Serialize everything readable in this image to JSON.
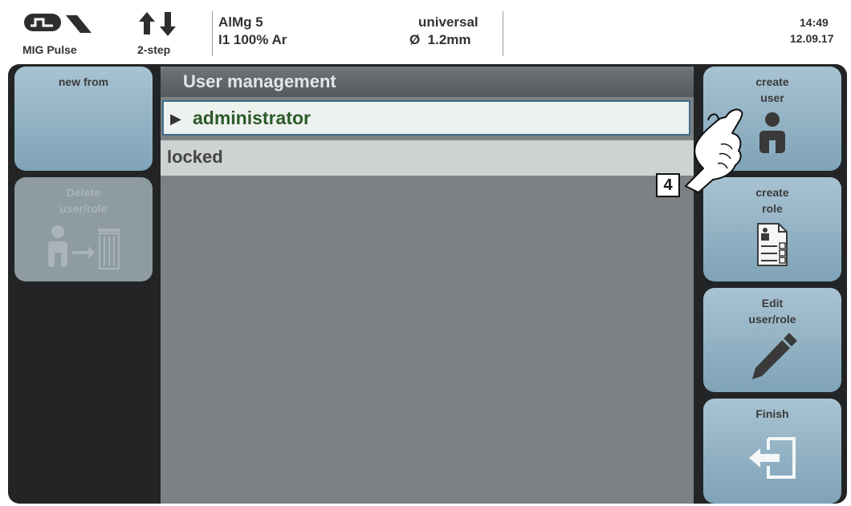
{
  "status_bar": {
    "process": "MIG Pulse",
    "mode": "2-step",
    "material": "AlMg 5",
    "gas": "I1 100% Ar",
    "wire_type": "universal",
    "wire_diameter": "Ø  1.2mm",
    "time": "14:49",
    "date": "12.09.17",
    "icons": [
      "pulse-process-icon",
      "two-step-mode-icon"
    ]
  },
  "left_buttons": {
    "new_from": "new from",
    "delete_line1": "Delete",
    "delete_line2": "user/role"
  },
  "panel": {
    "title": "User management",
    "items": [
      {
        "label": "administrator",
        "selected": true
      },
      {
        "label": "locked",
        "selected": false
      }
    ]
  },
  "right_buttons": {
    "create_user_line1": "create",
    "create_user_line2": "user",
    "create_role_line1": "create",
    "create_role_line2": "role",
    "edit_line1": "Edit",
    "edit_line2": "user/role",
    "finish": "Finish"
  },
  "callout": "4",
  "colors": {
    "button_blue": "#8fb0c3",
    "panel_grey": "#7e8183",
    "selected_text": "#2d5a2a",
    "screen_bg": "#222426"
  }
}
